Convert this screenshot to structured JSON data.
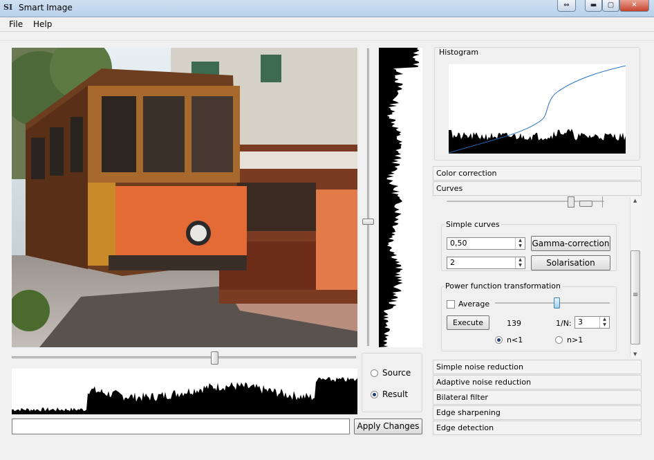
{
  "window": {
    "title": "Smart Image",
    "app_icon": "SI"
  },
  "menu": {
    "file": "File",
    "help": "Help"
  },
  "preview": {
    "radio_source": "Source",
    "radio_result": "Result",
    "apply_button": "Apply Changes",
    "selected_view": "Result"
  },
  "panel": {
    "histogram_title": "Histogram",
    "sections_top": [
      "Color correction",
      "Curves"
    ],
    "sections_bottom": [
      "Simple noise reduction",
      "Adaptive noise reduction",
      "Bilateral filter",
      "Edge sharpening",
      "Edge detection"
    ],
    "simple_curves": {
      "title": "Simple curves",
      "gamma_value": "0,50",
      "gamma_button": "Gamma-correction",
      "solar_value": "2",
      "solar_button": "Solarisation"
    },
    "power": {
      "title": "Power function transformation",
      "average_label": "Average",
      "average_checked": false,
      "execute_button": "Execute",
      "value_readout": "139",
      "inv_n_label": "1/N:",
      "inv_n_value": "3",
      "option_lt": "n<1",
      "option_gt": "n>1",
      "selected_option": "n<1"
    }
  },
  "colors": {
    "curve": "#1f6fc5",
    "accent": "#1f3f73",
    "scroll_icon": "≡"
  }
}
